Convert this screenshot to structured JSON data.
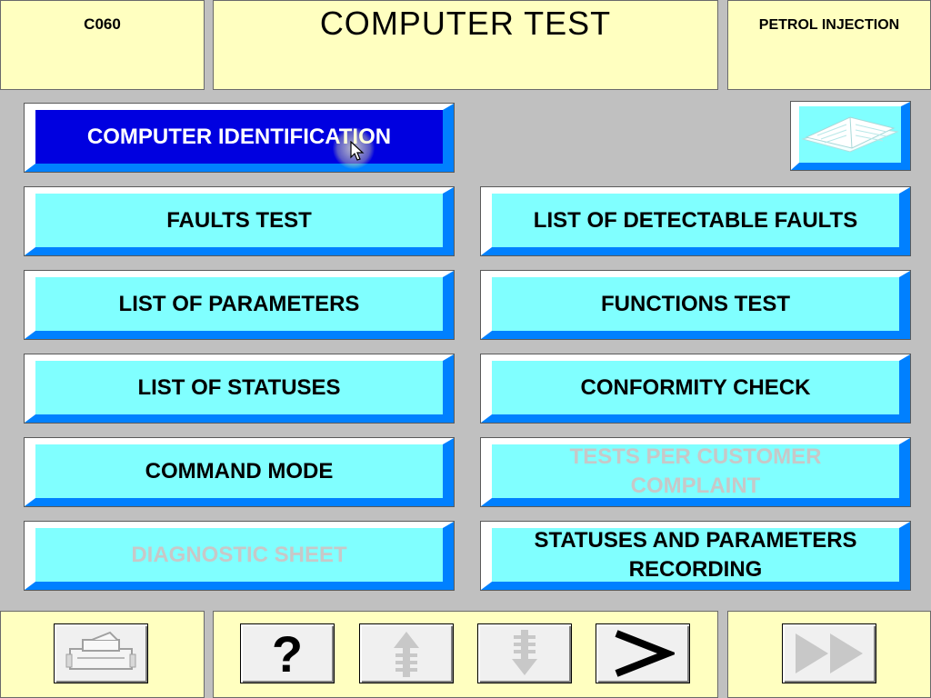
{
  "header": {
    "code": "C060",
    "title": "COMPUTER TEST",
    "system": "PETROL INJECTION"
  },
  "menu": {
    "computer_identification": "COMPUTER IDENTIFICATION",
    "faults_test": "FAULTS TEST",
    "list_of_detectable_faults": "LIST OF DETECTABLE FAULTS",
    "list_of_parameters": "LIST OF PARAMETERS",
    "functions_test": "FUNCTIONS TEST",
    "list_of_statuses": "LIST OF STATUSES",
    "conformity_check": "CONFORMITY CHECK",
    "command_mode": "COMMAND MODE",
    "tests_per_customer_complaint": "TESTS PER CUSTOMER COMPLAINT",
    "diagnostic_sheet": "DIAGNOSTIC SHEET",
    "statuses_and_parameters_recording": "STATUSES AND PARAMETERS RECORDING"
  },
  "toolbar": {
    "help_label": "?",
    "icons": [
      "printer-icon",
      "help-icon",
      "scroll-up-icon",
      "scroll-down-icon",
      "next-icon",
      "fast-forward-icon"
    ]
  },
  "colors": {
    "panel": "#ffffc0",
    "background": "#c0c0c0",
    "button_face": "#80ffff",
    "button_shadow": "#0080ff",
    "selected": "#0000e0",
    "disabled_text": "#c8c8c8"
  }
}
